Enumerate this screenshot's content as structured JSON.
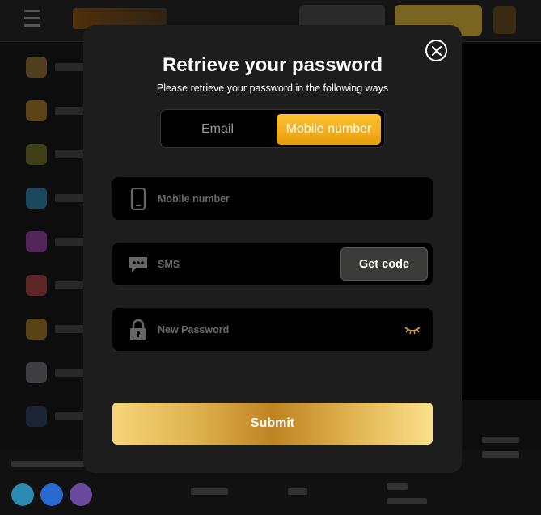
{
  "modal": {
    "title": "Retrieve your password",
    "subtitle": "Please retrieve your password in the following ways",
    "close_icon": "close-icon"
  },
  "tabs": [
    {
      "label": "Email",
      "active": false
    },
    {
      "label": "Mobile number",
      "active": true
    }
  ],
  "fields": {
    "mobile": {
      "placeholder": "Mobile number",
      "value": "",
      "icon": "phone-icon"
    },
    "sms": {
      "placeholder": "SMS",
      "value": "",
      "icon": "message-icon"
    },
    "password": {
      "placeholder": "New Password",
      "value": "",
      "icon": "lock-icon",
      "toggle_icon": "eye-closed-icon"
    }
  },
  "buttons": {
    "get_code": "Get code",
    "submit": "Submit"
  },
  "colors": {
    "accent": "#f0a814",
    "modal_bg": "#1d1d1d",
    "field_bg": "#000000"
  }
}
